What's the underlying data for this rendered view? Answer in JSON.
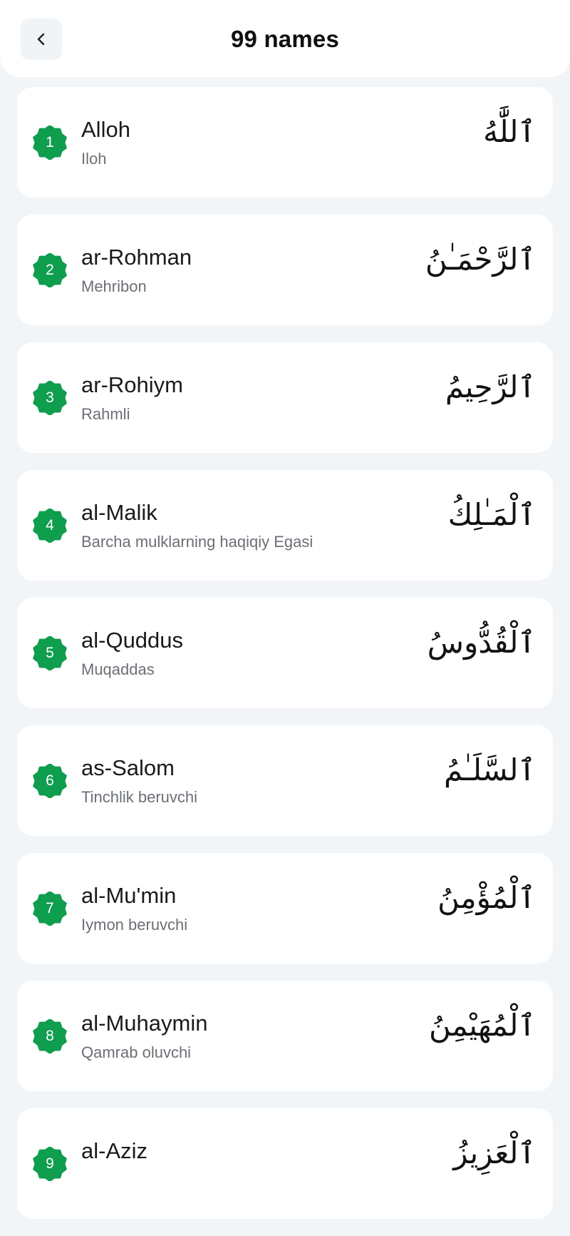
{
  "header": {
    "title": "99 names",
    "back_icon": "chevron-left-icon"
  },
  "colors": {
    "accent": "#0f9d4e",
    "background": "#f2f5f8",
    "card": "#ffffff"
  },
  "names": [
    {
      "number": "1",
      "name": "Alloh",
      "meaning": "Iloh",
      "arabic": "ٱللَّٰهُ"
    },
    {
      "number": "2",
      "name": "ar-Rohman",
      "meaning": "Mehribon",
      "arabic": "ٱلرَّحْمَـٰنُ"
    },
    {
      "number": "3",
      "name": "ar-Rohiym",
      "meaning": "Rahmli",
      "arabic": "ٱلرَّحِيمُ"
    },
    {
      "number": "4",
      "name": "al-Malik",
      "meaning": "Barcha mulklarning haqiqiy Egasi",
      "arabic": "ٱلْمَـٰلِكُ"
    },
    {
      "number": "5",
      "name": "al-Quddus",
      "meaning": "Muqaddas",
      "arabic": "ٱلْقُدُّوسُ"
    },
    {
      "number": "6",
      "name": "as-Salom",
      "meaning": "Tinchlik beruvchi",
      "arabic": "ٱلسَّلَـٰمُ"
    },
    {
      "number": "7",
      "name": "al-Mu'min",
      "meaning": "Iymon beruvchi",
      "arabic": "ٱلْمُؤْمِنُ"
    },
    {
      "number": "8",
      "name": "al-Muhaymin",
      "meaning": "Qamrab oluvchi",
      "arabic": "ٱلْمُهَيْمِنُ"
    },
    {
      "number": "9",
      "name": "al-Aziz",
      "meaning": "",
      "arabic": "ٱلْعَزِيزُ"
    }
  ]
}
